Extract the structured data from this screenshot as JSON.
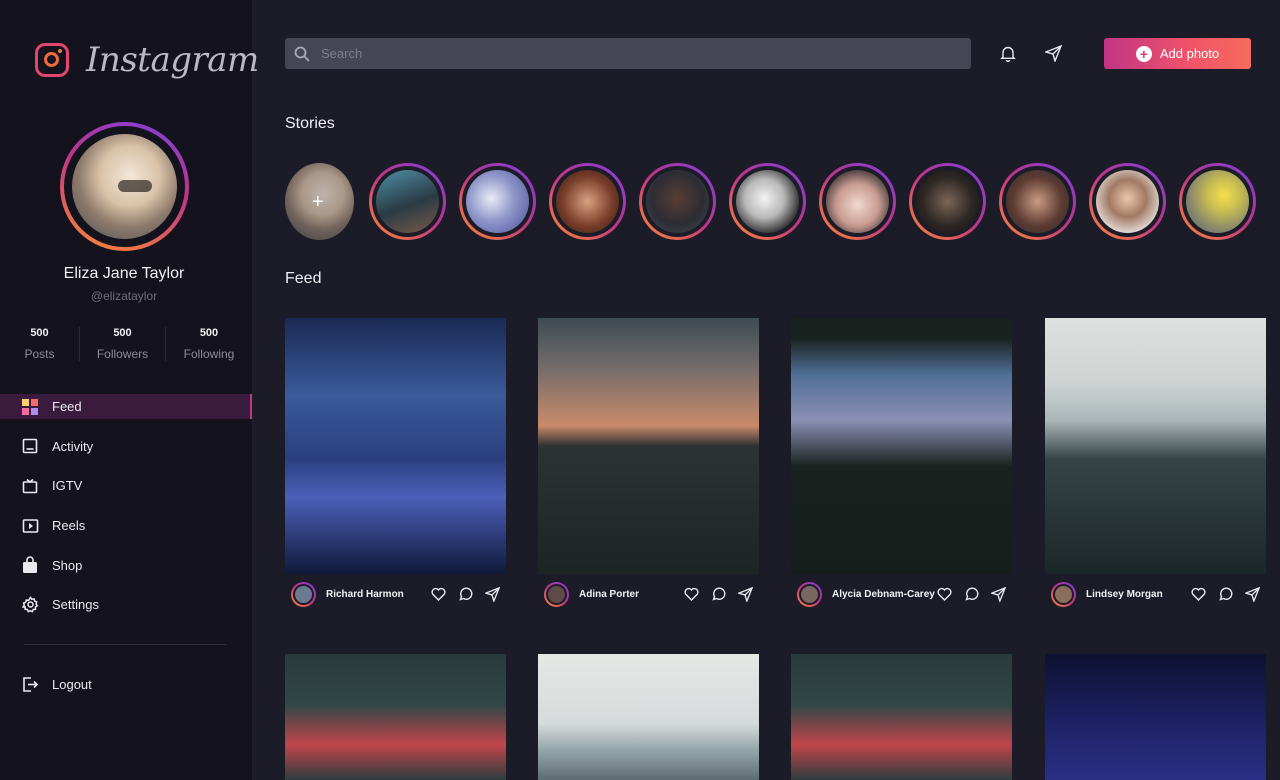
{
  "brand": {
    "name": "Instagram"
  },
  "profile": {
    "name": "Eliza Jane Taylor",
    "handle": "@elizataylor",
    "stats": [
      {
        "value": "500",
        "label": "Posts"
      },
      {
        "value": "500",
        "label": "Followers"
      },
      {
        "value": "500",
        "label": "Following"
      }
    ]
  },
  "nav": {
    "items": [
      {
        "label": "Feed",
        "icon": "grid-icon",
        "active": true
      },
      {
        "label": "Activity",
        "icon": "activity-icon"
      },
      {
        "label": "IGTV",
        "icon": "tv-icon"
      },
      {
        "label": "Reels",
        "icon": "play-icon"
      },
      {
        "label": "Shop",
        "icon": "bag-icon"
      },
      {
        "label": "Settings",
        "icon": "gear-icon"
      }
    ],
    "logout": "Logout"
  },
  "search": {
    "placeholder": "Search"
  },
  "header": {
    "add_photo": "Add photo"
  },
  "sections": {
    "stories": "Stories",
    "feed": "Feed"
  },
  "stories": [
    {
      "type": "own"
    },
    {
      "type": "story"
    },
    {
      "type": "story"
    },
    {
      "type": "story"
    },
    {
      "type": "story"
    },
    {
      "type": "story"
    },
    {
      "type": "story"
    },
    {
      "type": "story"
    },
    {
      "type": "story"
    },
    {
      "type": "story"
    },
    {
      "type": "story"
    }
  ],
  "feed": [
    {
      "author": "Richard Harmon"
    },
    {
      "author": "Adina Porter"
    },
    {
      "author": "Alycia Debnam-Carey"
    },
    {
      "author": "Lindsey Morgan"
    }
  ],
  "colors": {
    "accent_gradient_start": "#c13584",
    "accent_gradient_end": "#f46b5c",
    "sidebar_bg": "#14131d",
    "main_bg": "#1c1b28"
  }
}
